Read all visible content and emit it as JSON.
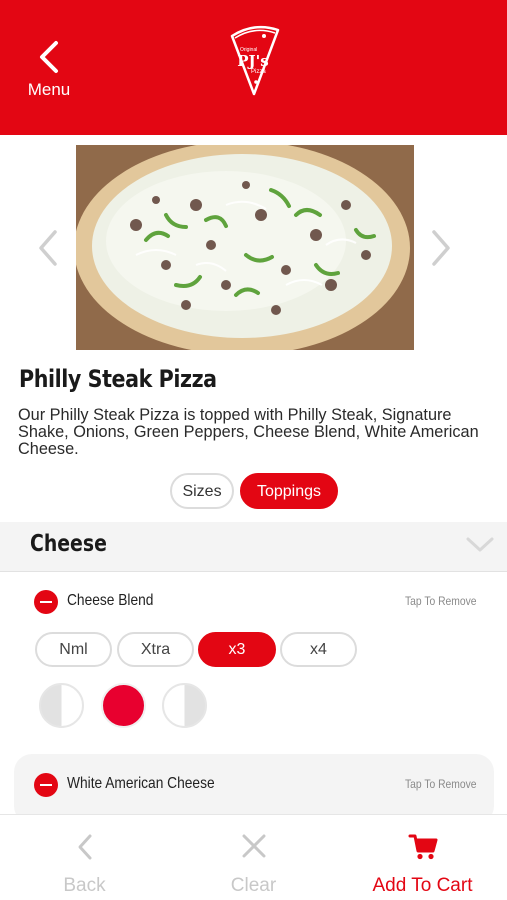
{
  "header": {
    "back_label": "Menu",
    "logo_text": "PJ's",
    "logo_small_top": "Original",
    "logo_small_bottom": "Pizza"
  },
  "product": {
    "title": "Philly Steak Pizza",
    "description": "Our Philly Steak Pizza is topped with Philly Steak, Signature Shake, Onions, Green Peppers, Cheese Blend, White American Cheese."
  },
  "tabs": [
    {
      "label": "Sizes",
      "active": false
    },
    {
      "label": "Toppings",
      "active": true
    }
  ],
  "section": {
    "title": "Cheese"
  },
  "toppings": [
    {
      "name": "Cheese Blend",
      "action": "Tap To Remove",
      "amounts": [
        "Nml",
        "Xtra",
        "x3",
        "x4"
      ],
      "selected_amount": "x3",
      "portion": "whole"
    },
    {
      "name": "White American Cheese",
      "action": "Tap To Remove"
    }
  ],
  "bottom_bar": {
    "back": "Back",
    "clear": "Clear",
    "add_to_cart": "Add To Cart"
  },
  "colors": {
    "brand_red": "#e30613",
    "inactive_gray": "#c8c8c8"
  }
}
